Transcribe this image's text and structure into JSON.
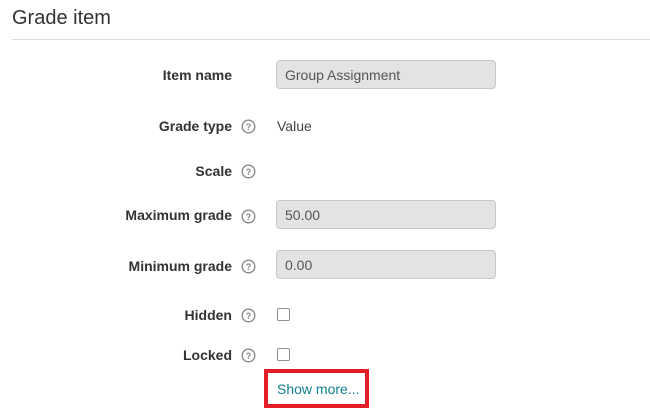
{
  "section": {
    "title": "Grade item"
  },
  "form": {
    "item_name": {
      "label": "Item name",
      "value": "Group Assignment"
    },
    "grade_type": {
      "label": "Grade type",
      "value": "Value",
      "help_icon": "question-circle-icon"
    },
    "scale": {
      "label": "Scale",
      "help_icon": "question-circle-icon"
    },
    "maximum_grade": {
      "label": "Maximum grade",
      "value": "50.00",
      "help_icon": "question-circle-icon"
    },
    "minimum_grade": {
      "label": "Minimum grade",
      "value": "0.00",
      "help_icon": "question-circle-icon"
    },
    "hidden": {
      "label": "Hidden",
      "checked": false,
      "help_icon": "question-circle-icon"
    },
    "locked": {
      "label": "Locked",
      "checked": false,
      "help_icon": "question-circle-icon"
    }
  },
  "show_more": {
    "label": "Show more...",
    "link_color": "#0f7f8f",
    "highlight_color": "#e41e26"
  }
}
